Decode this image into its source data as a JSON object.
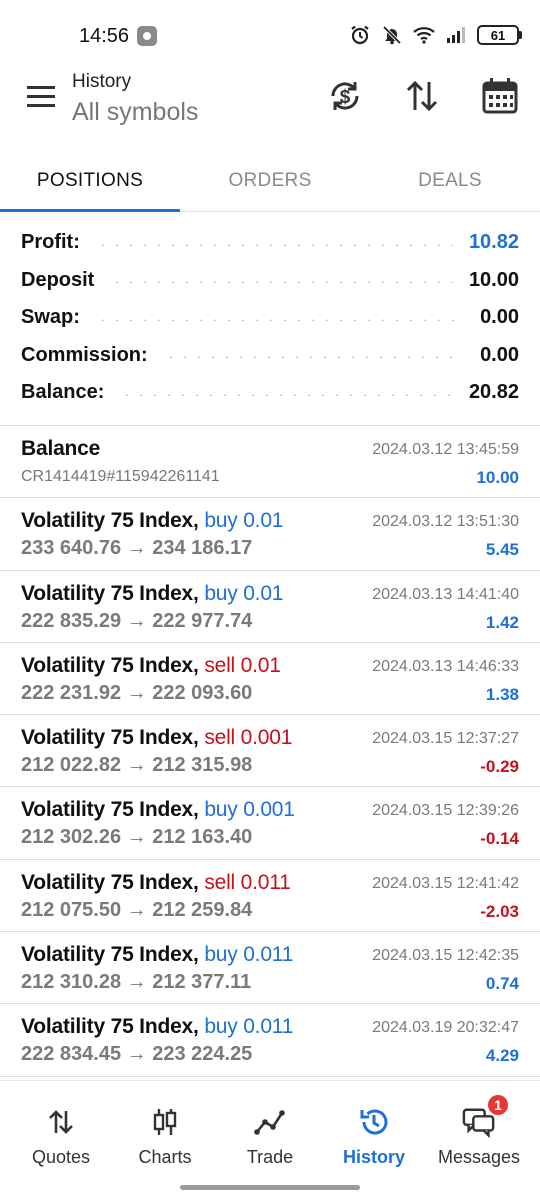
{
  "status_bar": {
    "time": "14:56",
    "battery": "61"
  },
  "app_bar": {
    "title_small": "History",
    "title_big": "All symbols"
  },
  "tabs": [
    {
      "label": "POSITIONS",
      "active": true
    },
    {
      "label": "ORDERS",
      "active": false
    },
    {
      "label": "DEALS",
      "active": false
    }
  ],
  "summary": [
    {
      "label": "Profit:",
      "value": "10.82",
      "highlight": true
    },
    {
      "label": "Deposit",
      "value": "10.00",
      "highlight": false
    },
    {
      "label": "Swap:",
      "value": "0.00",
      "highlight": false
    },
    {
      "label": "Commission:",
      "value": "0.00",
      "highlight": false
    },
    {
      "label": "Balance:",
      "value": "20.82",
      "highlight": false
    }
  ],
  "balance_row": {
    "title": "Balance",
    "ref": "CR1414419#115942261141",
    "time": "2024.03.12 13:45:59",
    "amount": "10.00"
  },
  "positions": [
    {
      "symbol": "Volatility 75 Index,",
      "side": "buy 0.01",
      "direction": "buy",
      "prices": "233 640.76 → 234 186.17",
      "time": "2024.03.12 13:51:30",
      "profit": "5.45",
      "sign": "pos"
    },
    {
      "symbol": "Volatility 75 Index,",
      "side": "buy 0.01",
      "direction": "buy",
      "prices": "222 835.29 → 222 977.74",
      "time": "2024.03.13 14:41:40",
      "profit": "1.42",
      "sign": "pos"
    },
    {
      "symbol": "Volatility 75 Index,",
      "side": "sell 0.01",
      "direction": "sell",
      "prices": "222 231.92 → 222 093.60",
      "time": "2024.03.13 14:46:33",
      "profit": "1.38",
      "sign": "pos"
    },
    {
      "symbol": "Volatility 75 Index,",
      "side": "sell 0.001",
      "direction": "sell",
      "prices": "212 022.82 → 212 315.98",
      "time": "2024.03.15 12:37:27",
      "profit": "-0.29",
      "sign": "neg"
    },
    {
      "symbol": "Volatility 75 Index,",
      "side": "buy 0.001",
      "direction": "buy",
      "prices": "212 302.26 → 212 163.40",
      "time": "2024.03.15 12:39:26",
      "profit": "-0.14",
      "sign": "neg"
    },
    {
      "symbol": "Volatility 75 Index,",
      "side": "sell 0.011",
      "direction": "sell",
      "prices": "212 075.50 → 212 259.84",
      "time": "2024.03.15 12:41:42",
      "profit": "-2.03",
      "sign": "neg"
    },
    {
      "symbol": "Volatility 75 Index,",
      "side": "buy 0.011",
      "direction": "buy",
      "prices": "212 310.28 → 212 377.11",
      "time": "2024.03.15 12:42:35",
      "profit": "0.74",
      "sign": "pos"
    },
    {
      "symbol": "Volatility 75 Index,",
      "side": "buy 0.011",
      "direction": "buy",
      "prices": "222 834.45 → 223 224.25",
      "time": "2024.03.19 20:32:47",
      "profit": "4.29",
      "sign": "pos"
    }
  ],
  "bottom_nav": [
    {
      "label": "Quotes",
      "icon": "quotes-arrows-icon",
      "active": false
    },
    {
      "label": "Charts",
      "icon": "candlestick-icon",
      "active": false
    },
    {
      "label": "Trade",
      "icon": "trade-line-icon",
      "active": false
    },
    {
      "label": "History",
      "icon": "history-clock-icon",
      "active": true
    },
    {
      "label": "Messages",
      "icon": "messages-icon",
      "active": false,
      "badge": "1"
    }
  ],
  "colors": {
    "accent": "#1e6fd6",
    "sell": "#c4121a",
    "muted": "#7a7a7a"
  }
}
